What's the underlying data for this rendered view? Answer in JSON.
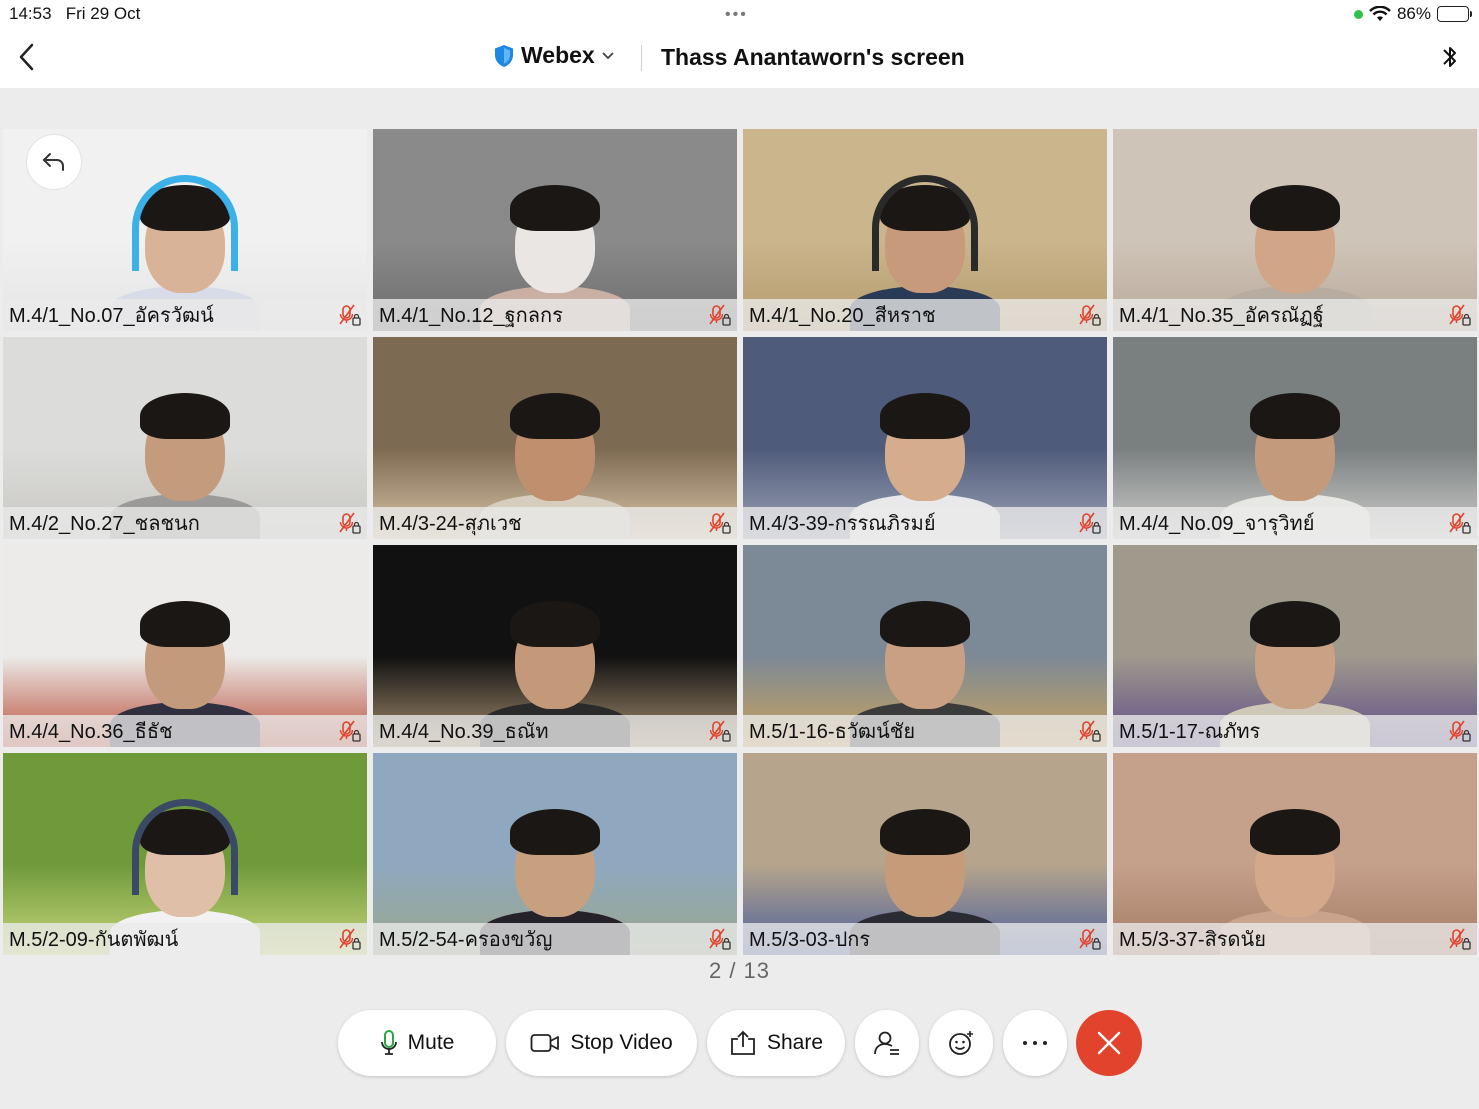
{
  "status_bar": {
    "time": "14:53",
    "date": "Fri 29 Oct",
    "battery": "86%",
    "battery_level": 0.86,
    "dot_color": "#2fc24b"
  },
  "header": {
    "app_name": "Webex",
    "title": "Thass Anantaworn's screen",
    "icons": [
      "back-chevron",
      "shield",
      "chevron-down",
      "bluetooth"
    ]
  },
  "participants": [
    {
      "name": "M.4/1_No.07_อัครวัฒน์",
      "muted": true,
      "bg": "#f1f1f1",
      "floor": "#e4e4e4",
      "skin": "#d9b398",
      "shirt": "#d8dce8",
      "headphones": "#3bb1e8"
    },
    {
      "name": "M.4/1_No.12_ฐกลกร",
      "muted": true,
      "bg": "#8a8a8a",
      "floor": "#6d6d6d",
      "skin": "#e9e6e4",
      "shirt": "#c9b0a2",
      "headphones": ""
    },
    {
      "name": "M.4/1_No.20_สีหราช",
      "muted": true,
      "bg": "#cbb58c",
      "floor": "#b59b6e",
      "skin": "#c69a7a",
      "shirt": "#2a3b55",
      "headphones": "#2a2a2a"
    },
    {
      "name": "M.4/1_No.35_อัครณัฏฐ์",
      "muted": true,
      "bg": "#cfc4b8",
      "floor": "#b9aa9a",
      "skin": "#d1a587",
      "shirt": "#b8aca0",
      "headphones": ""
    },
    {
      "name": "M.4/2_No.27_ชลชนก",
      "muted": true,
      "bg": "#dcdcda",
      "floor": "#c8c7c3",
      "skin": "#c49b7c",
      "shirt": "#9c9a98",
      "headphones": ""
    },
    {
      "name": "M.4/3-24-สุภเวช",
      "muted": true,
      "bg": "#7d6a52",
      "floor": "#d8c6a9",
      "skin": "#bf8f6e",
      "shirt": "#d6cdbf",
      "headphones": ""
    },
    {
      "name": "M.4/3-39-กรรณภิรมย์",
      "muted": true,
      "bg": "#4e5b7b",
      "floor": "#9ea3b5",
      "skin": "#d6ad8c",
      "shirt": "#e9e8ea",
      "headphones": ""
    },
    {
      "name": "M.4/4_No.09_จารุวิทย์",
      "muted": true,
      "bg": "#7a7f80",
      "floor": "#cfd0cc",
      "skin": "#c49a7c",
      "shirt": "#e7e7e4",
      "headphones": ""
    },
    {
      "name": "M.4/4_No.36_ธีธัช",
      "muted": true,
      "bg": "#ecebe9",
      "floor": "#b84b36",
      "skin": "#c49a7c",
      "shirt": "#303040",
      "headphones": ""
    },
    {
      "name": "M.4/4_No.39_ธณัท",
      "muted": true,
      "bg": "#111111",
      "floor": "#a89070",
      "skin": "#c4997a",
      "shirt": "#2a2a2a",
      "headphones": ""
    },
    {
      "name": "M.5/1-16-ธวัฒน์ชัย",
      "muted": true,
      "bg": "#7c8996",
      "floor": "#c9a35d",
      "skin": "#caa084",
      "shirt": "#3b3b3b",
      "headphones": ""
    },
    {
      "name": "M.5/1-17-ณภัทร",
      "muted": true,
      "bg": "#9f9a8c",
      "floor": "#5e4d89",
      "skin": "#c9a184",
      "shirt": "#cfc8b8",
      "headphones": ""
    },
    {
      "name": "M.5/2-09-กันตพัฒน์",
      "muted": true,
      "bg": "#6f9a3a",
      "floor": "#c7d67a",
      "skin": "#dfbfa7",
      "shirt": "#f2f2f2",
      "headphones": "#3a4a66"
    },
    {
      "name": "M.5/2-54-ครองขวัญ",
      "muted": true,
      "bg": "#8fa8bf",
      "floor": "#9aa78c",
      "skin": "#c7a07f",
      "shirt": "#26222a",
      "headphones": ""
    },
    {
      "name": "M.5/3-03-ปกร",
      "muted": true,
      "bg": "#b6a58c",
      "floor": "#4c5f9a",
      "skin": "#c59b7a",
      "shirt": "#2b2b33",
      "headphones": ""
    },
    {
      "name": "M.5/3-37-สิรดนัย",
      "muted": true,
      "bg": "#c5a08a",
      "floor": "#a57c66",
      "skin": "#d4a88a",
      "shirt": "#c9a38b",
      "headphones": ""
    }
  ],
  "pager": "2 / 13",
  "controls": {
    "mute_label": "Mute",
    "stop_video_label": "Stop Video",
    "share_label": "Share"
  },
  "colors": {
    "end_call": "#e2432d",
    "mic_off": "#e2432d",
    "brand_shield": "#1e88e5",
    "mute_mic": "#27a844"
  }
}
